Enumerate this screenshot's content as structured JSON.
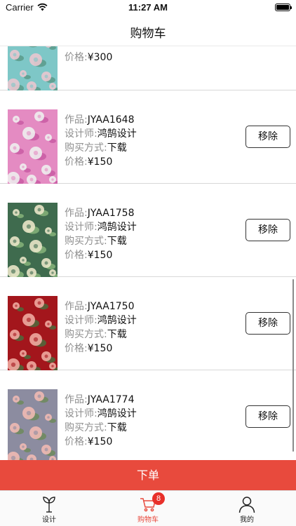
{
  "status_bar": {
    "carrier": "Carrier",
    "time": "11:27 AM"
  },
  "header": {
    "title": "购物车"
  },
  "labels": {
    "work": "作品:",
    "designer": "设计师:",
    "purchase": "购买方式:",
    "price": "价格:"
  },
  "remove_label": "移除",
  "items": [
    {
      "work": "",
      "designer": "",
      "purchase": "",
      "price": "¥300",
      "pattern_bg": "#7ec7c7",
      "pattern_flower": "#e9c6cf",
      "pattern_leaf": "#5b9a8a"
    },
    {
      "work": "JYAA1648",
      "designer": "鸿鹄设计",
      "purchase": "下载",
      "price": "¥150",
      "pattern_bg": "#e48bc2",
      "pattern_flower": "#eeeeee",
      "pattern_leaf": "#c95aa3"
    },
    {
      "work": "JYAA1758",
      "designer": "鸿鹄设计",
      "purchase": "下载",
      "price": "¥150",
      "pattern_bg": "#3f6b4e",
      "pattern_flower": "#e9e6c8",
      "pattern_leaf": "#86b37a"
    },
    {
      "work": "JYAA1750",
      "designer": "鸿鹄设计",
      "purchase": "下载",
      "price": "¥150",
      "pattern_bg": "#a3161c",
      "pattern_flower": "#f0a8a0",
      "pattern_leaf": "#4c6b3c"
    },
    {
      "work": "JYAA1774",
      "designer": "鸿鹄设计",
      "purchase": "下载",
      "price": "¥150",
      "pattern_bg": "#8c8ca0",
      "pattern_flower": "#efb9b3",
      "pattern_leaf": "#6d8a5c"
    }
  ],
  "order_button": {
    "label": "下单"
  },
  "tabs": [
    {
      "label": "设计",
      "icon": "sprout-icon"
    },
    {
      "label": "购物车",
      "icon": "cart-icon",
      "badge": "8"
    },
    {
      "label": "我的",
      "icon": "user-icon"
    }
  ],
  "colors": {
    "accent": "#e84a3d",
    "badge": "#e8302a"
  }
}
